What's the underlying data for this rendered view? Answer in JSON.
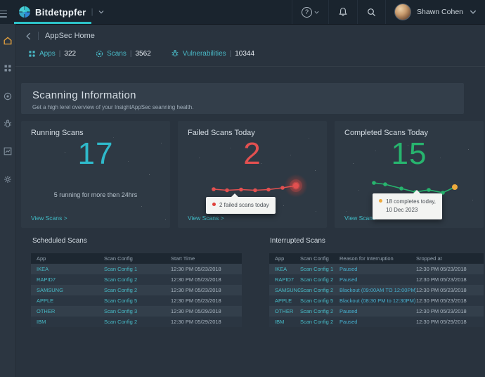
{
  "topbar": {
    "brand": "Bitdetppfer",
    "divider": "|",
    "user_name": "Shawn Cohen"
  },
  "breadcrumb": {
    "title": "AppSec Home"
  },
  "stats": {
    "divider": "|",
    "items": [
      {
        "label": "Apps",
        "value": "322"
      },
      {
        "label": "Scans",
        "value": "3562"
      },
      {
        "label": "Vulnerabilities",
        "value": "10344"
      }
    ]
  },
  "banner": {
    "title": "Scanning Information",
    "subtitle": "Get a high lerel overview of your InsightAppSec seanning health."
  },
  "cards": {
    "running": {
      "title": "Running Scans",
      "value": "17",
      "subtitle": "5 running for more then 24hrs",
      "link": "View Scans >"
    },
    "failed": {
      "title": "Failed Scans Today",
      "value": "2",
      "tooltip": "2 failed scans today",
      "link": "View Scans >"
    },
    "completed": {
      "title": "Completed Scans Today",
      "value": "15",
      "tooltip_line1": "18 completes today,",
      "tooltip_line2": "10 Dec 2023",
      "link": "View Scans >"
    }
  },
  "chart_data": [
    {
      "type": "line",
      "svg_id": "spark-failed",
      "series_name": "Failed Scans Today sparkline",
      "color": "#e25050",
      "glow_last": true,
      "points": [
        [
          7,
          13
        ],
        [
          26,
          14.5
        ],
        [
          46,
          13.5
        ],
        [
          66,
          14.5
        ],
        [
          85,
          13.5
        ],
        [
          105,
          11
        ],
        [
          124,
          8
        ]
      ],
      "annotation": "2 failed scans today"
    },
    {
      "type": "line",
      "svg_id": "spark-completed",
      "series_name": "Completed Scans Today sparkline",
      "color": "#27b46e",
      "last_point_color": "#edaa3c",
      "points": [
        [
          10,
          4
        ],
        [
          26,
          6
        ],
        [
          49,
          12
        ],
        [
          69,
          17
        ],
        [
          88,
          14
        ],
        [
          108,
          18
        ],
        [
          125,
          10
        ]
      ],
      "annotation": "18 completes today, 10 Dec 2023"
    }
  ],
  "tables": {
    "scheduled": {
      "title": "Scheduled Scans",
      "columns": [
        "App",
        "Scan Config",
        "Start Time"
      ],
      "rows": [
        {
          "app": "IKEA",
          "config": "Scan Config 1",
          "time": "12:30 PM 05/23/2018"
        },
        {
          "app": "RAPID7",
          "config": "Scan Config 2",
          "time": "12:30 PM 05/23/2018"
        },
        {
          "app": "SAMSUNG",
          "config": "Scan Config 2",
          "time": "12:30 PM 05/23/2018"
        },
        {
          "app": "APPLE",
          "config": "Scan Config 5",
          "time": "12:30 PM 05/23/2018"
        },
        {
          "app": "OTHER",
          "config": "Scan Config 3",
          "time": "12:30 PM 05/29/2018"
        },
        {
          "app": "IBM",
          "config": "Scan Config 2",
          "time": "12:30 PM 05/29/2018"
        }
      ]
    },
    "interrupted": {
      "title": "Interrupted Scans",
      "columns": [
        "App",
        "Scan Config",
        "Reason for Interruption",
        "Sropped at"
      ],
      "rows": [
        {
          "app": "IKEA",
          "config": "Scan Config 1",
          "reason": "Paused",
          "time": "12:30 PM 05/23/2018"
        },
        {
          "app": "RAPID7",
          "config": "Scan Config 2",
          "reason": "Paused",
          "time": "12:30 PM 05/23/2018"
        },
        {
          "app": "SAMSUNG",
          "config": "Scan Config 2",
          "reason": "Blackout (09:00AM TO 12:00PM)",
          "time": "12:30 PM 05/23/2018"
        },
        {
          "app": "APPLE",
          "config": "Scan Config 5",
          "reason": "Blackout (08:30 PM to 12:30PM)",
          "time": "12:30 PM 05/23/2018"
        },
        {
          "app": "OTHER",
          "config": "Scan Config 2",
          "reason": "Paused",
          "time": "12:30 PM 05/23/2018"
        },
        {
          "app": "IBM",
          "config": "Scan Config 2",
          "reason": "Paused",
          "time": "12:30 PM 05/29/2018"
        }
      ]
    }
  }
}
